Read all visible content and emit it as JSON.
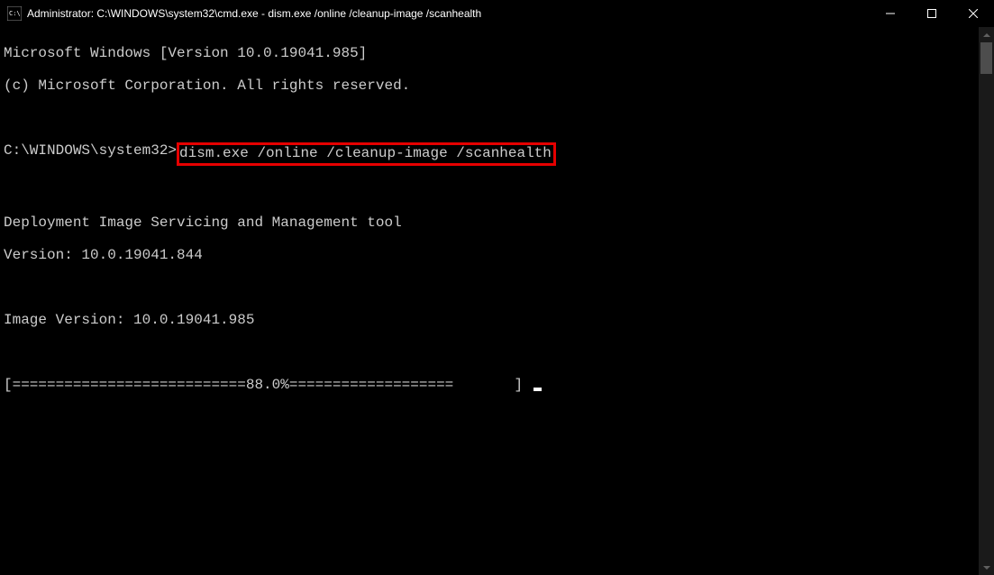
{
  "titlebar": {
    "title": "Administrator: C:\\WINDOWS\\system32\\cmd.exe - dism.exe  /online /cleanup-image /scanhealth"
  },
  "terminal": {
    "line1": "Microsoft Windows [Version 10.0.19041.985]",
    "line2": "(c) Microsoft Corporation. All rights reserved.",
    "blank1": "",
    "prompt_prefix": "C:\\WINDOWS\\system32>",
    "prompt_command": "dism.exe /online /cleanup-image /scanhealth",
    "blank2": "",
    "tool_name": "Deployment Image Servicing and Management tool",
    "tool_version": "Version: 10.0.19041.844",
    "blank3": "",
    "image_version": "Image Version: 10.0.19041.985",
    "blank4": "",
    "progress": "[===========================88.0%===================       ] "
  }
}
